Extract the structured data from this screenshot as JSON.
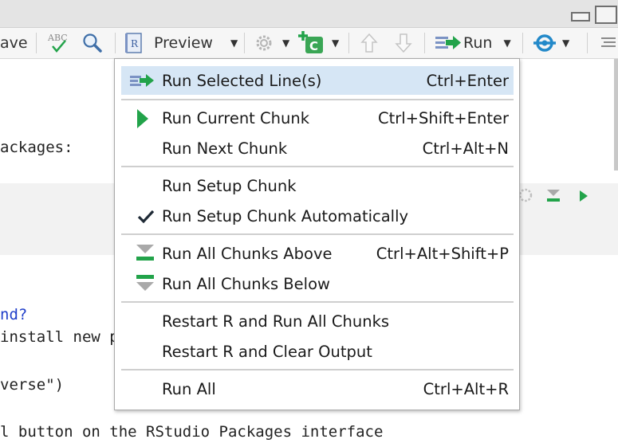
{
  "toolbar": {
    "save_label": "ave",
    "spell_label": "ABC",
    "preview_label": "Preview",
    "insert_chunk_label": "C",
    "run_label": "Run"
  },
  "editor": {
    "lines": [
      {
        "text": "ackages:"
      },
      {
        "text": "nd?",
        "blue": true
      },
      {
        "text": "install new p"
      },
      {
        "text": "verse\")"
      },
      {
        "text": "l button on the RStudio Packages interface"
      }
    ]
  },
  "menu": {
    "items": [
      {
        "label": "Run Selected Line(s)",
        "shortcut": "Ctrl+Enter",
        "icon": "run-lines-icon",
        "selected": true
      },
      {
        "label": "Run Current Chunk",
        "shortcut": "Ctrl+Shift+Enter",
        "icon": "play-triangle-icon"
      },
      {
        "label": "Run Next Chunk",
        "shortcut": "Ctrl+Alt+N",
        "icon": ""
      },
      {
        "label": "Run Setup Chunk",
        "shortcut": "",
        "icon": ""
      },
      {
        "label": "Run Setup Chunk Automatically",
        "shortcut": "",
        "icon": "checkmark-icon"
      },
      {
        "label": "Run All Chunks Above",
        "shortcut": "Ctrl+Alt+Shift+P",
        "icon": "run-above-icon"
      },
      {
        "label": "Run All Chunks Below",
        "shortcut": "",
        "icon": "run-below-icon"
      },
      {
        "label": "Restart R and Run All Chunks",
        "shortcut": "",
        "icon": ""
      },
      {
        "label": "Restart R and Clear Output",
        "shortcut": "",
        "icon": ""
      },
      {
        "label": "Run All",
        "shortcut": "Ctrl+Alt+R",
        "icon": ""
      }
    ]
  },
  "colors": {
    "accent_green": "#22a34a",
    "selection": "#d6e6f5",
    "blue_code": "#1f3ec9"
  }
}
